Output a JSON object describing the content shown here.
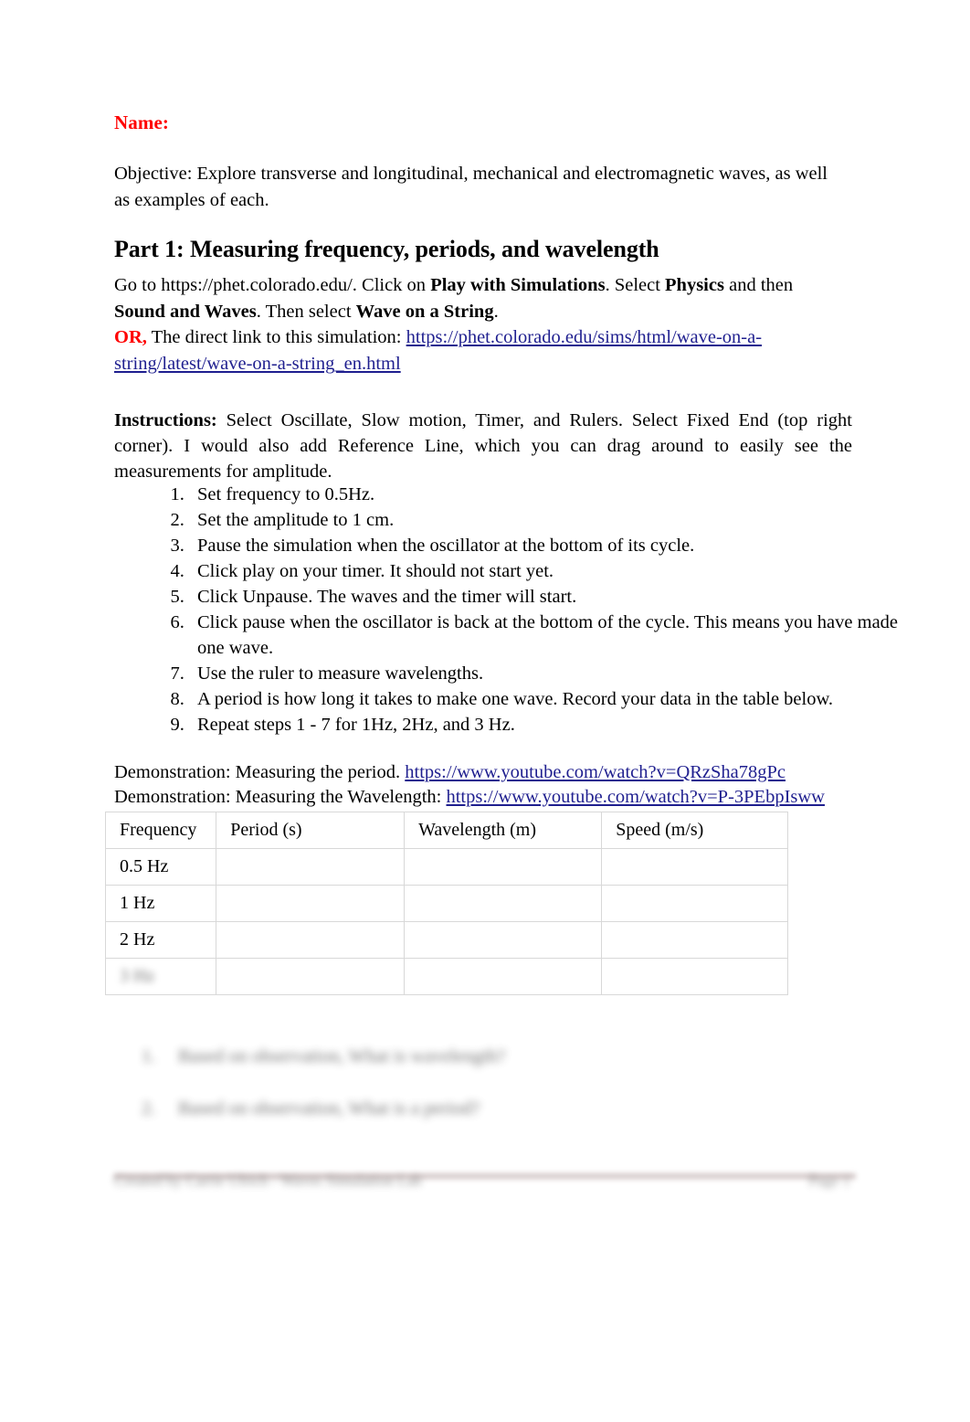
{
  "document": {
    "name_label": "Name:",
    "objective": "Objective: Explore transverse and longitudinal, mechanical and electromagnetic waves, as well as examples of each."
  },
  "part1": {
    "heading": "Part 1: Measuring frequency, periods, and wavelength",
    "intro": {
      "seg1": "Go to https://phet.colorado.edu/. Click on ",
      "bold1": "Play with Simulations",
      "seg2": ". Select ",
      "bold2": "Physics",
      "seg3": " and then ",
      "bold3": "Sound and Waves",
      "seg4": ". Then select ",
      "bold4": "Wave on a String",
      "seg5": ".",
      "or_label": "OR,",
      "seg6": " The direct link to this simulation: ",
      "sim_link": "https://phet.colorado.edu/sims/html/wave-on-a-string/latest/wave-on-a-string_en.html"
    },
    "instructions": {
      "label": "Instructions:",
      "text": " Select Oscillate, Slow motion, Timer, and Rulers. Select Fixed End (top right corner). I would also add Reference Line, which you can drag around to easily see the measurements for amplitude."
    },
    "steps": [
      "Set frequency to 0.5Hz.",
      "Set the amplitude to 1 cm.",
      "Pause the simulation when the oscillator at the bottom of its cycle.",
      "Click play on your timer. It should not start yet.",
      "Click Unpause. The waves and the timer will start.",
      "Click pause when the oscillator is back at the bottom of the cycle. This means you have made one wave.",
      "Use the ruler to measure wavelengths.",
      "A period is how long it takes to make one wave.  Record your data in the table below.",
      "Repeat steps 1 - 7 for 1Hz, 2Hz, and 3 Hz."
    ],
    "demos": [
      {
        "label": "Demonstration: Measuring the period. ",
        "link": "https://www.youtube.com/watch?v=QRzSha78gPc"
      },
      {
        "label": "Demonstration: Measuring the Wavelength: ",
        "link": "https://www.youtube.com/watch?v=P-3PEbpIsww"
      }
    ],
    "table": {
      "headers": [
        "Frequency",
        "Period (s)",
        "Wavelength (m)",
        "Speed (m/s)"
      ],
      "rows": [
        [
          "0.5 Hz",
          "",
          "",
          ""
        ],
        [
          "1 Hz",
          "",
          "",
          ""
        ],
        [
          "2 Hz",
          "",
          "",
          ""
        ],
        [
          "3 Hz",
          "",
          "",
          ""
        ]
      ]
    },
    "questions": [
      {
        "num": "1.",
        "text": "Based on observation, What is wavelength?"
      },
      {
        "num": "2.",
        "text": "Based on observation, What is a period?"
      }
    ]
  },
  "footer": {
    "text": "Created by Carrie Ulrich - Waves Simulation Lab",
    "page": "Page 1"
  },
  "colors": {
    "name_red": "#ff0000",
    "link_blue": "#1f1f8f",
    "table_border": "#d8d8d8",
    "text": "#000000"
  }
}
